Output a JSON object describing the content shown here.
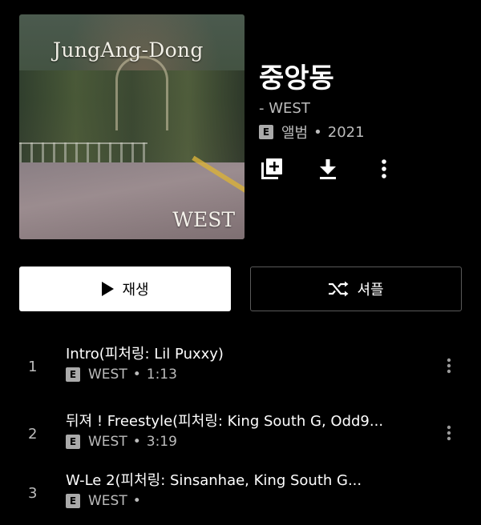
{
  "album": {
    "cover_title": "JungAng-Dong",
    "cover_artist": "WEST",
    "title": "중앙동",
    "artist_line": "- WEST",
    "explicit_badge": "E",
    "type": "앨범",
    "separator": "•",
    "year": "2021"
  },
  "actions": {
    "icons": [
      "add-to-library-icon",
      "download-icon",
      "more-vert-icon"
    ]
  },
  "buttons": {
    "play_label": "재생",
    "shuffle_label": "셔플"
  },
  "tracks": [
    {
      "number": "1",
      "title": "Intro(피처링: Lil Puxxy)",
      "explicit": "E",
      "artist": "WEST",
      "separator": "•",
      "duration": "1:13"
    },
    {
      "number": "2",
      "title": "뒤져 ! Freestyle(피처링: King South G, Odd9...",
      "explicit": "E",
      "artist": "WEST",
      "separator": "•",
      "duration": "3:19"
    },
    {
      "number": "3",
      "title": "W-Le 2(피처링: Sinsanhae, King South G...",
      "explicit": "E",
      "artist": "WEST",
      "separator": "•",
      "duration": ""
    }
  ],
  "colors": {
    "background": "#000000",
    "text_primary": "#ffffff",
    "text_secondary": "#bcbcbc",
    "play_button_bg": "#ffffff",
    "shuffle_border": "#5a5a5a"
  }
}
